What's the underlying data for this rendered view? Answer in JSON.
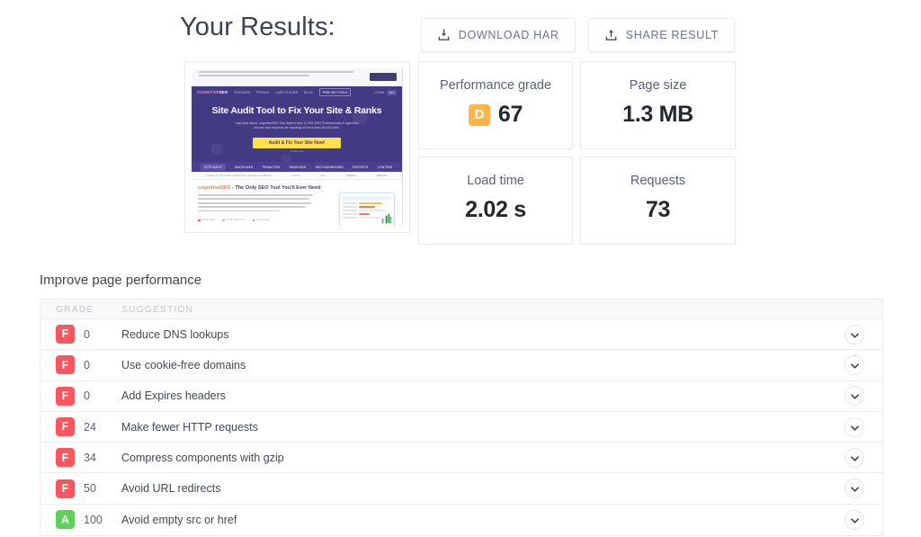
{
  "header": {
    "title": "Your Results:",
    "actions": [
      {
        "label": "DOWNLOAD HAR",
        "icon": "download-tray-icon"
      },
      {
        "label": "SHARE RESULT",
        "icon": "upload-tray-icon"
      }
    ]
  },
  "thumbnail": {
    "alt": "site-screenshot-preview",
    "cookie_button": "I ACCEPT",
    "logo_part1": "COGNITIVE",
    "logo_part2": "SEO",
    "nav": [
      "FEATURES",
      "PRICING",
      "CASE STUDIES",
      "BLOG"
    ],
    "nav_cta": "FREE SEO TOOLS",
    "nav_right": [
      "LOGIN",
      "TRY"
    ],
    "headline": "Site Audit Tool to Fix Your Site & Ranks",
    "sub_line1": "Last year alone, cognitiveSEO has helped over 11.000 SEO Professionals & Agencies",
    "sub_line2": "recover and improve the rankings of more than 36.000 sites.",
    "cta": "Audit & Fix Your Site Now!",
    "cta_sub": "- it's free, too! -",
    "tabs": [
      "SITE AUDIT",
      "BACKLINKS",
      "PENALTIES",
      "RANKINGS",
      "SEO DASHBOARD",
      "REPORTS",
      "CONTENT"
    ],
    "trust": [
      "Trusted by Thousands of SEO Pros, Agencies and Brands",
      "Ahrefs",
      "Moz",
      "Majestic",
      "SEMrush"
    ],
    "body_title_1": "cognitiveSEO",
    "body_title_2": " - The Only SEO Tool You'll Ever Need",
    "body_paragraph": "Our all-inclusive Site Audit tool is part of a complete SEO Software suite that covers all the needs an SEO Pro, webmaster or digital marketer might have - Backlink Analysis, technical SEO Audits, content audits, keywords research & rank tracking, content optimization, Google Penalty prevention and recovery, and much much more.",
    "chips": [
      "BACKLINKS",
      "RANK TRACKING",
      "SITE AUDIT"
    ]
  },
  "metrics": [
    {
      "label": "Performance grade",
      "value": "67",
      "grade": "D",
      "grade_color": "#fcb54a"
    },
    {
      "label": "Page size",
      "value": "1.3 MB",
      "grade": null,
      "grade_color": null
    },
    {
      "label": "Load time",
      "value": "2.02 s",
      "grade": null,
      "grade_color": null
    },
    {
      "label": "Requests",
      "value": "73",
      "grade": null,
      "grade_color": null
    }
  ],
  "suggestions": {
    "title": "Improve page performance",
    "columns": {
      "grade": "GRADE",
      "suggestion": "SUGGESTION"
    },
    "toggle_icon": "chevron-down-icon",
    "rows": [
      {
        "grade": "F",
        "color": "#f8575f",
        "score": "0",
        "text": "Reduce DNS lookups"
      },
      {
        "grade": "F",
        "color": "#f8575f",
        "score": "0",
        "text": "Use cookie-free domains"
      },
      {
        "grade": "F",
        "color": "#f8575f",
        "score": "0",
        "text": "Add Expires headers"
      },
      {
        "grade": "F",
        "color": "#f8575f",
        "score": "24",
        "text": "Make fewer HTTP requests"
      },
      {
        "grade": "F",
        "color": "#f8575f",
        "score": "34",
        "text": "Compress components with gzip"
      },
      {
        "grade": "F",
        "color": "#f8575f",
        "score": "50",
        "text": "Avoid URL redirects"
      },
      {
        "grade": "A",
        "color": "#5cd15c",
        "score": "100",
        "text": "Avoid empty src or href"
      }
    ]
  },
  "colors": {
    "grade_f": "#f8575f",
    "grade_a": "#5cd15c",
    "grade_d": "#fcb54a",
    "brand_purple": "#433a84",
    "cta_yellow": "#ffe14d"
  }
}
